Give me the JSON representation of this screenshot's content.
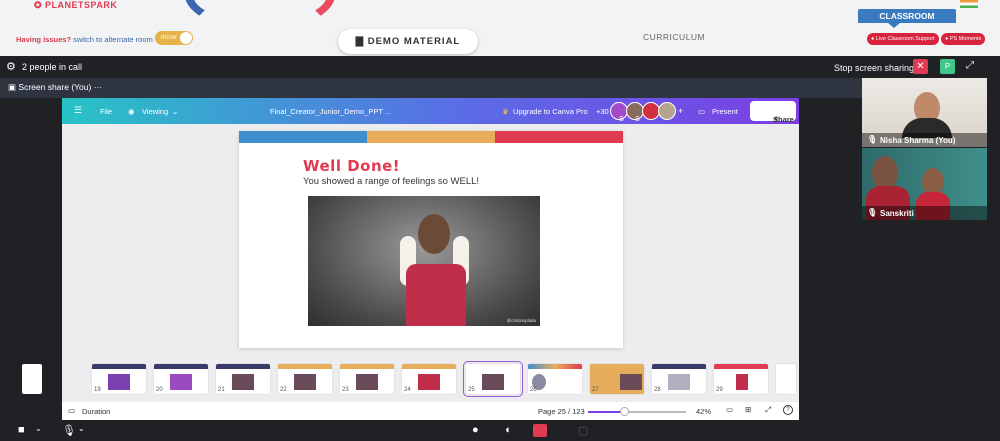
{
  "header": {
    "logo": "PLANETSPARK",
    "issues_text": "Having issues?",
    "alternate_link": "switch to alternate room",
    "toggle_label": "ROOM",
    "demo_button": "DEMO MATERIAL",
    "curriculum": "CURRICULUM",
    "classroom": "CLASSROOM",
    "live_support": "Live Classroom Support",
    "ps_moments": "PS Moments"
  },
  "call": {
    "people": "2 people in call",
    "stop_sharing": "Stop screen sharing",
    "close_glyph": "✕",
    "p_badge": "P",
    "screen_share": "Screen share (You)",
    "more": "···"
  },
  "canva": {
    "menu": "☰",
    "file": "File",
    "viewing": "Viewing",
    "doc_title": "Final_Creator_Junior_Demo_PPT ...",
    "upgrade": "Upgrade to Canva Pro",
    "count": "+30",
    "av1": "S",
    "av2": "S",
    "plus": "+",
    "present": "Present",
    "share": "Share"
  },
  "slide": {
    "title": "Well Done!",
    "subtitle": "You showed a range of feelings so WELL!",
    "watermark": "@cristiospitala",
    "stripe_colors": [
      "#3f8fcf",
      "#e8ad5a",
      "#e03b50"
    ]
  },
  "thumbnails": [
    {
      "num": "19",
      "band": "#3a3a6a"
    },
    {
      "num": "20",
      "band": "#3a3a6a"
    },
    {
      "num": "21",
      "band": "#3a3a6a"
    },
    {
      "num": "22",
      "band": "#e8ad5a"
    },
    {
      "num": "23",
      "band": "#e8ad5a"
    },
    {
      "num": "24",
      "band": "#e8ad5a"
    },
    {
      "num": "25",
      "band": "#ffffff"
    },
    {
      "num": "26",
      "band": "#e03b50"
    },
    {
      "num": "27",
      "band": "#e8ad5a"
    },
    {
      "num": "28",
      "band": "#3a3a6a"
    },
    {
      "num": "29",
      "band": "#e03b50"
    }
  ],
  "footer": {
    "duration": "Duration",
    "page": "Page 25 / 123",
    "zoom": "42%",
    "zoom_level": 0.37,
    "help": "?"
  },
  "participants": [
    {
      "name": "Nisha Sharma (You)"
    },
    {
      "name": "Sanskriti"
    }
  ]
}
